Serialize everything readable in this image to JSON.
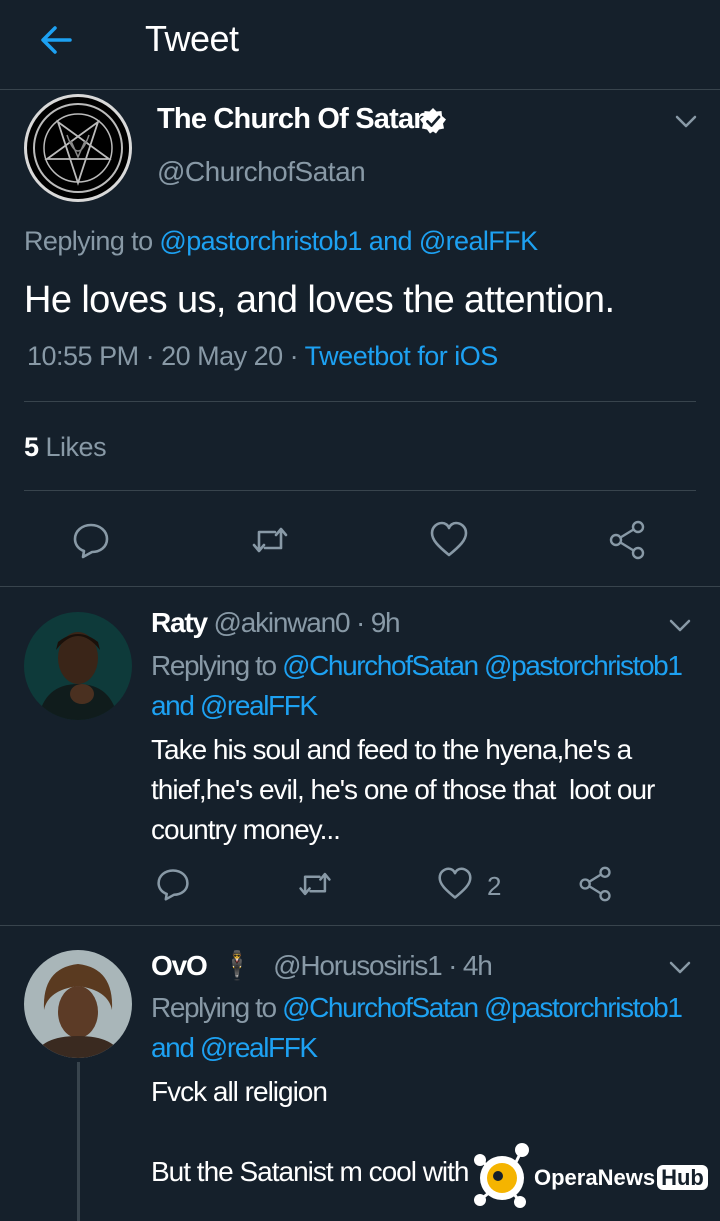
{
  "header": {
    "title": "Tweet"
  },
  "tweet": {
    "name": "The Church Of Satan",
    "handle": "@ChurchofSatan",
    "replying_prefix": "Replying to ",
    "replying_to_1": "@pastorchristob1",
    "replying_and": " and ",
    "replying_to_2": "@realFFK",
    "text": "He loves us, and loves the attention.",
    "time": "10:55 PM",
    "sep": " · ",
    "date": "20 May 20",
    "client": "Tweetbot for iOS",
    "likes_count": "5",
    "likes_label": " Likes"
  },
  "replies": [
    {
      "name": "Raty",
      "handle": " @akinwan0",
      "age": " · 9h",
      "reply_prefix": "Replying to ",
      "reply_user_1": "@ChurchofSatan",
      "reply_user_2": " @pastorchristob1",
      "reply_and": "and ",
      "reply_user_3": "@realFFK",
      "text": "Take his soul and feed to the hyena,he's a\nthief,he's evil, he's one of those that  loot our\ncountry money...",
      "like_count": "2"
    },
    {
      "name": "OvO",
      "emoji": "🕴",
      "handle": " @Horusosiris1",
      "age": " · 4h",
      "reply_prefix": "Replying to ",
      "reply_user_1": "@ChurchofSatan",
      "reply_user_2": " @pastorchristob1",
      "reply_and": "and ",
      "reply_user_3": "@realFFK",
      "text": "Fvck all religion\n\nBut the Satanist m cool with"
    }
  ],
  "watermark": {
    "brand": "OperaNews",
    "hub": "Hub"
  },
  "colors": {
    "background": "#15202b",
    "accent": "#1da1f2",
    "muted": "#8899a6",
    "divider": "#38444d"
  }
}
